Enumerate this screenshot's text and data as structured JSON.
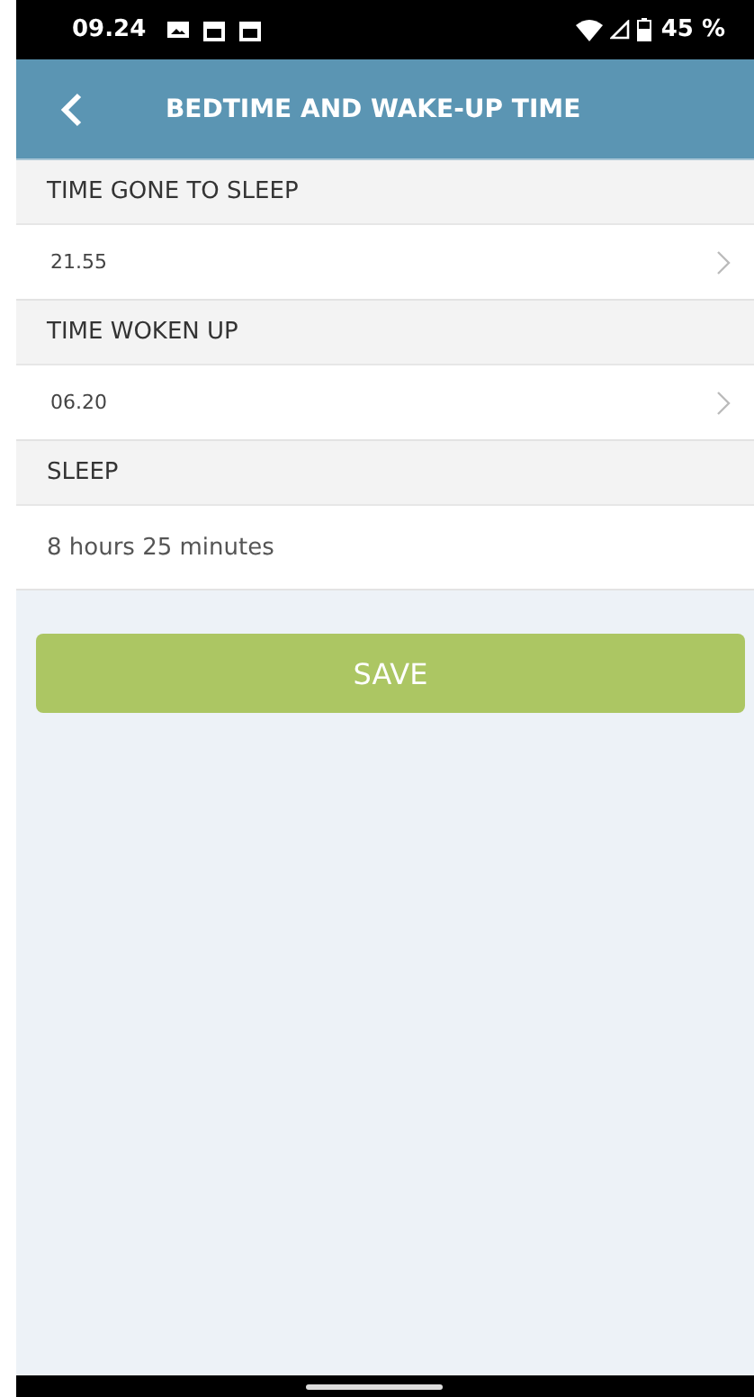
{
  "status_bar": {
    "time": "09.24",
    "battery": "45 %"
  },
  "header": {
    "title": "BEDTIME AND WAKE-UP TIME"
  },
  "sections": [
    {
      "label": "TIME GONE TO SLEEP",
      "value": "21.55",
      "kind": "picker"
    },
    {
      "label": "TIME WOKEN UP",
      "value": "06.20",
      "kind": "picker"
    },
    {
      "label": "SLEEP",
      "value": "8 hours 25 minutes",
      "kind": "text"
    }
  ],
  "save_button": {
    "label": "SAVE"
  }
}
